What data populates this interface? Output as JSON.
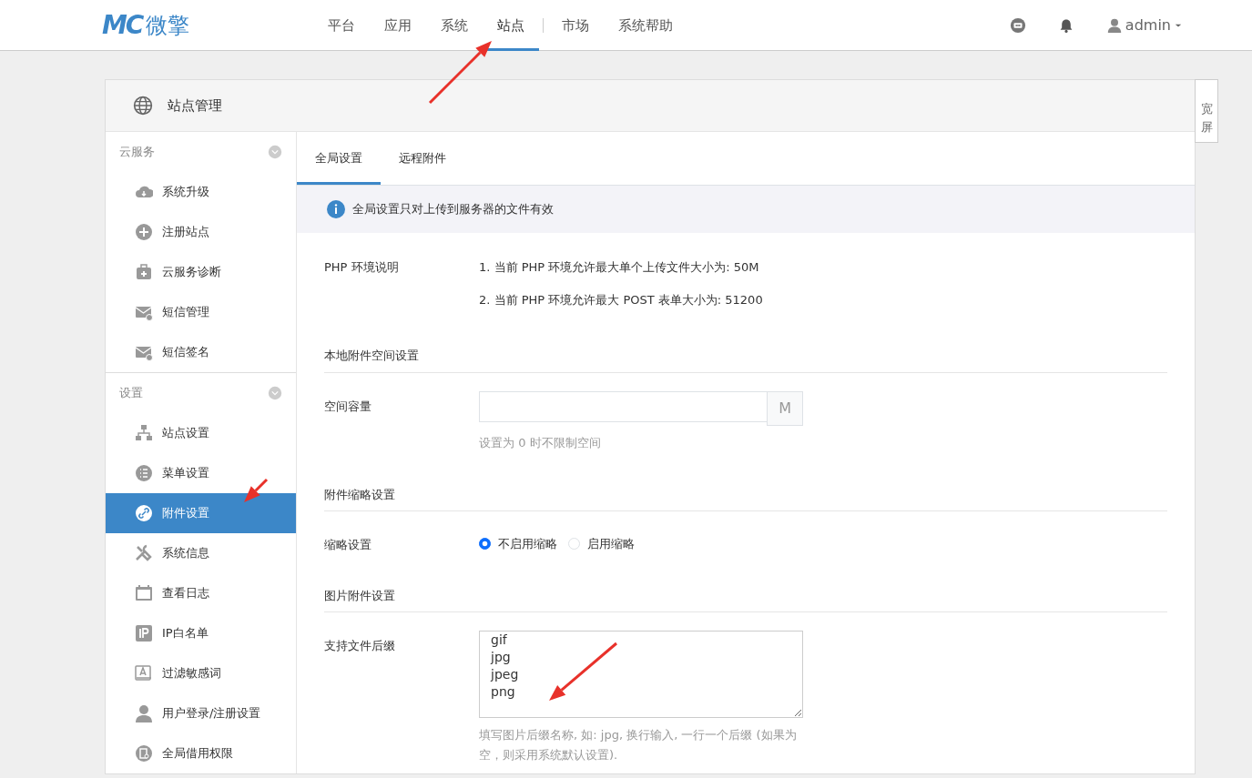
{
  "navbar": {
    "logo_mark": "MC",
    "logo_text": "微擎",
    "menu": [
      {
        "label": "平台",
        "selected": false
      },
      {
        "label": "应用",
        "selected": false
      },
      {
        "label": "系统",
        "selected": false
      },
      {
        "label": "站点",
        "selected": true
      },
      {
        "label": "市场",
        "selected": false
      },
      {
        "label": "系统帮助",
        "selected": false
      }
    ],
    "user": "admin"
  },
  "panel": {
    "title": "站点管理",
    "wide_toggle": "宽屏"
  },
  "sidebar": [
    {
      "title": "云服务",
      "items": [
        {
          "label": "系统升级",
          "selected": false
        },
        {
          "label": "注册站点",
          "selected": false
        },
        {
          "label": "云服务诊断",
          "selected": false
        },
        {
          "label": "短信管理",
          "selected": false
        },
        {
          "label": "短信签名",
          "selected": false
        }
      ]
    },
    {
      "title": "设置",
      "items": [
        {
          "label": "站点设置",
          "selected": false
        },
        {
          "label": "菜单设置",
          "selected": false
        },
        {
          "label": "附件设置",
          "selected": true
        },
        {
          "label": "系统信息",
          "selected": false
        },
        {
          "label": "查看日志",
          "selected": false
        },
        {
          "label": "IP白名单",
          "selected": false
        },
        {
          "label": "过滤敏感词",
          "selected": false
        },
        {
          "label": "用户登录/注册设置",
          "selected": false
        },
        {
          "label": "全局借用权限",
          "selected": false
        }
      ]
    }
  ],
  "tabs": [
    {
      "label": "全局设置",
      "selected": true
    },
    {
      "label": "远程附件",
      "selected": false
    }
  ],
  "notice": "全局设置只对上传到服务器的文件有效",
  "php_env": {
    "label": "PHP 环境说明",
    "lines": [
      "1. 当前 PHP 环境允许最大单个上传文件大小为: 50M",
      "2. 当前 PHP 环境允许最大 POST 表单大小为: 51200"
    ]
  },
  "sections": [
    {
      "title": "本地附件空间设置",
      "fields": [
        {
          "kind": "input",
          "label": "空间容量",
          "addon": "M",
          "help": "设置为 0 时不限制空间"
        }
      ]
    },
    {
      "title": "附件缩略设置",
      "fields": [
        {
          "kind": "radio",
          "label": "缩略设置",
          "options": [
            {
              "label": "不启用缩略",
              "selected": true
            },
            {
              "label": "启用缩略",
              "selected": false
            }
          ]
        }
      ]
    },
    {
      "title": "图片附件设置",
      "fields": [
        {
          "kind": "textarea",
          "label": "支持文件后缀",
          "lines": [
            "gif",
            "jpg",
            "jpeg",
            "png"
          ],
          "help": "填写图片后缀名称, 如: jpg, 换行输入, 一行一个后缀 (如果为空，则采用系统默认设置)."
        }
      ]
    }
  ]
}
